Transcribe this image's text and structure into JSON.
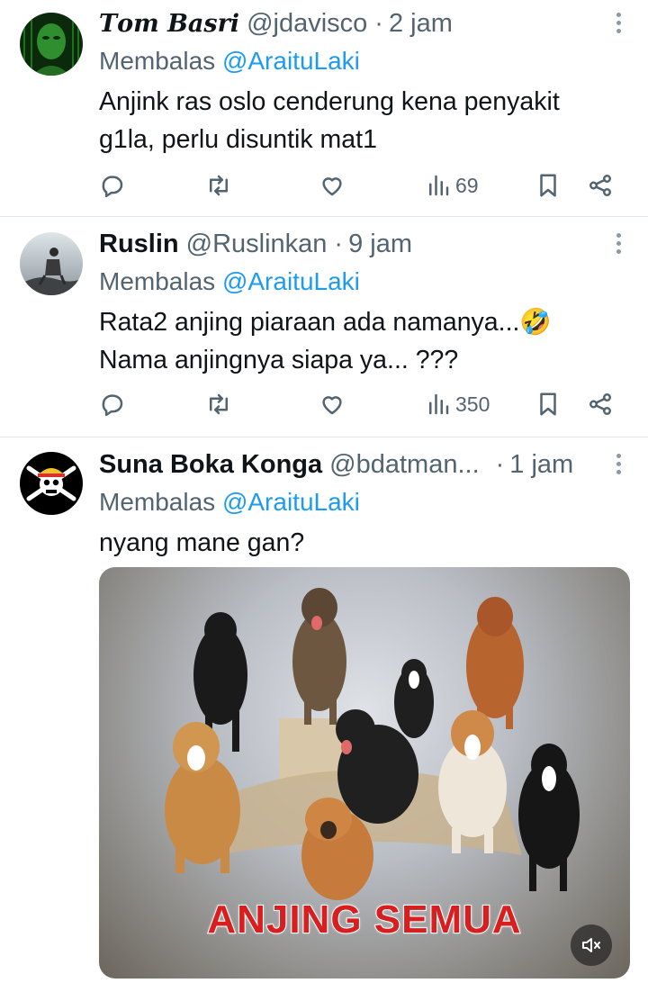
{
  "tweets": [
    {
      "name": "𝑻𝒐𝒎 𝑩𝒂𝒔𝒓𝒊",
      "handle": "@jdavisco",
      "sep": "·",
      "time": "2 jam",
      "reply_prefix": "Membalas",
      "reply_to": "@AraituLaki",
      "text": "Anjink ras oslo cenderung kena penyakit\ng1la, perlu disuntik mat1",
      "views": "69"
    },
    {
      "name": "Ruslin",
      "handle": "@Ruslinkan",
      "sep": "·",
      "time": "9 jam",
      "reply_prefix": "Membalas",
      "reply_to": "@AraituLaki",
      "text": "Rata2 anjing piaraan ada namanya...🤣\nNama anjingnya siapa ya... ???",
      "views": "350"
    },
    {
      "name": "Suna Boka Konga",
      "handle": "@bdatman...",
      "sep": "·",
      "time": "1 jam",
      "reply_prefix": "Membalas",
      "reply_to": "@AraituLaki",
      "text": "nyang mane gan?",
      "media_caption": "ANJING SEMUA"
    }
  ],
  "colors": {
    "accent": "#1d9bf0",
    "muted": "#536471",
    "text": "#0f1419",
    "caption": "#d81f1f"
  },
  "icons": [
    "reply-icon",
    "retweet-icon",
    "like-icon",
    "views-icon",
    "bookmark-icon",
    "share-icon",
    "more-icon",
    "mute-icon"
  ]
}
